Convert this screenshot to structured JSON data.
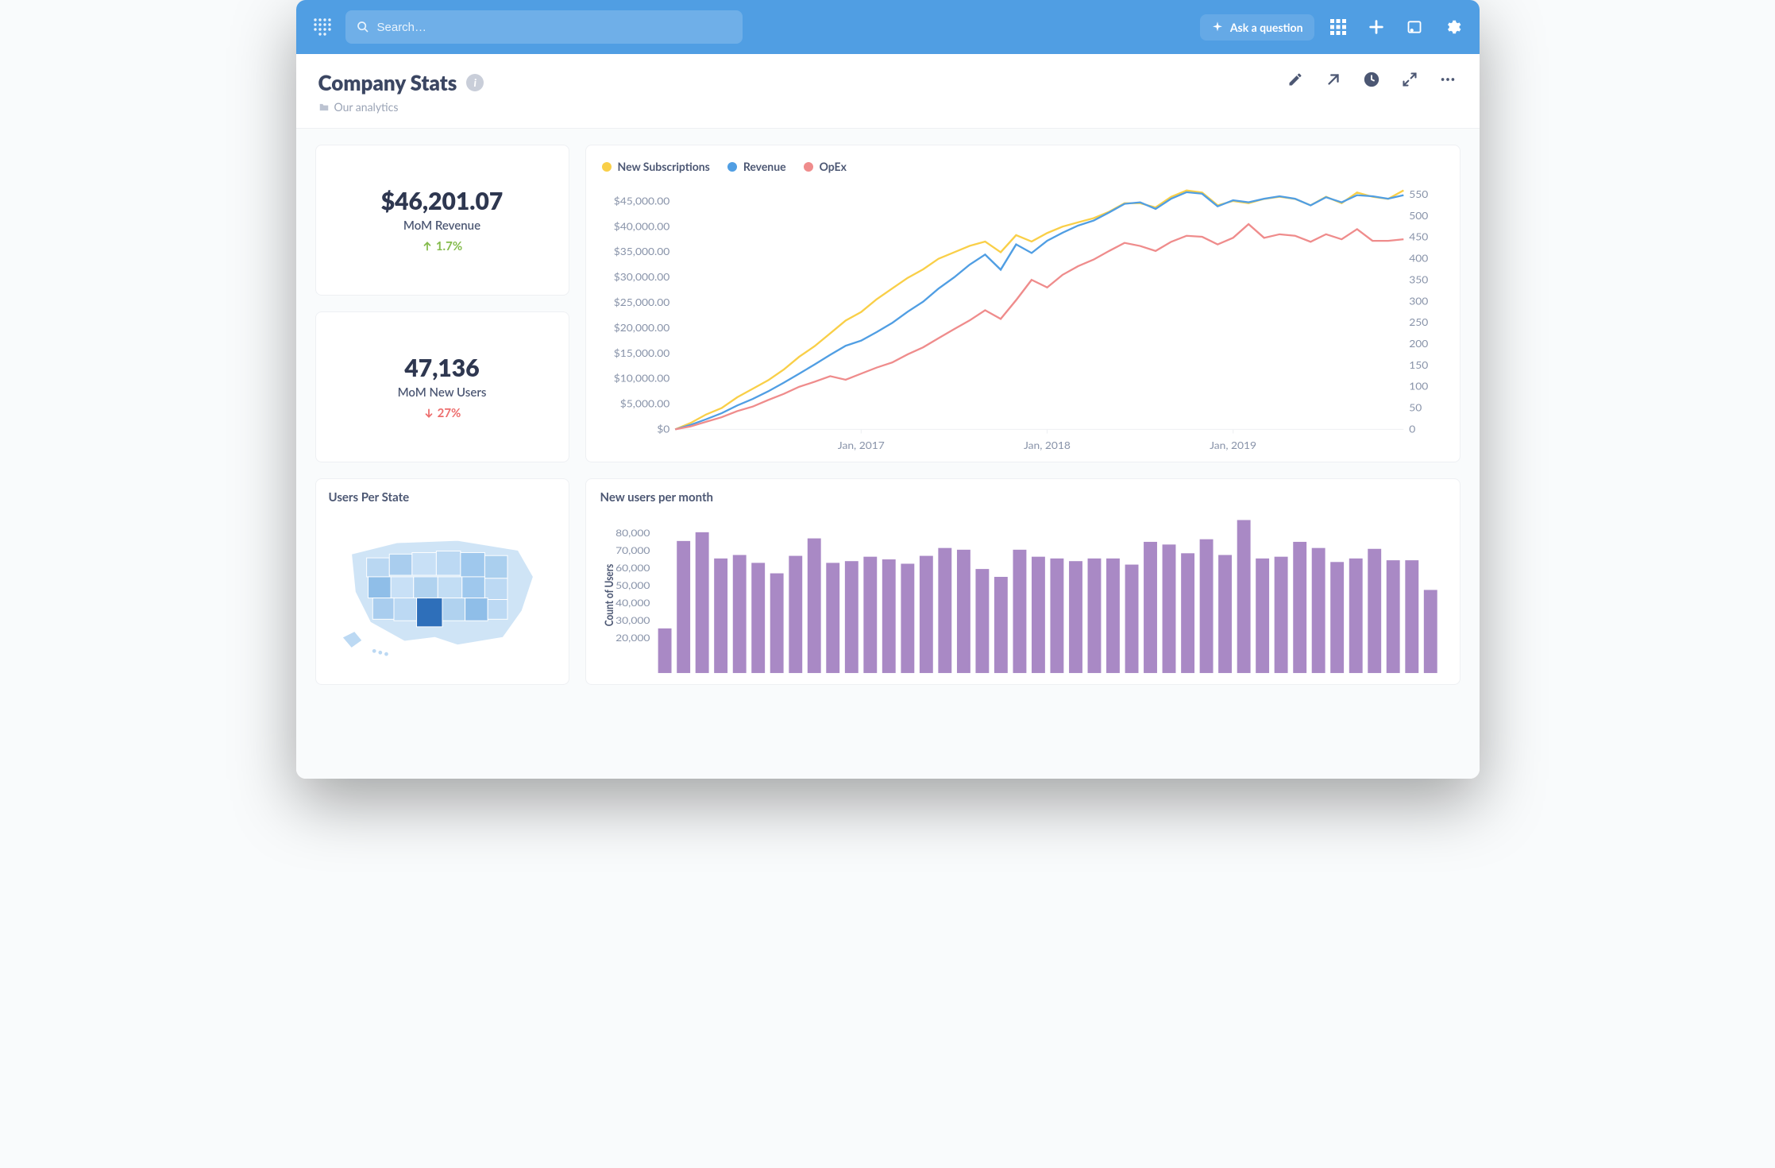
{
  "topbar": {
    "search_placeholder": "Search…",
    "ask_label": "Ask a question"
  },
  "header": {
    "title": "Company Stats",
    "breadcrumb": "Our analytics"
  },
  "kpis": [
    {
      "value": "$46,201.07",
      "label": "MoM Revenue",
      "delta": "1.7%",
      "direction": "up"
    },
    {
      "value": "47,136",
      "label": "MoM New Users",
      "delta": "27%",
      "direction": "down"
    }
  ],
  "line_chart": {
    "legend": [
      {
        "name": "New Subscriptions",
        "color": "#f9cf48"
      },
      {
        "name": "Revenue",
        "color": "#509ee3"
      },
      {
        "name": "OpEx",
        "color": "#ef8c8c"
      }
    ]
  },
  "map_card": {
    "title": "Users Per State"
  },
  "bar_card": {
    "title": "New users per month",
    "ylabel": "Count of Users"
  },
  "chart_data": [
    {
      "type": "line",
      "title": "",
      "x_ticks": [
        "Jan, 2017",
        "Jan, 2018",
        "Jan, 2019"
      ],
      "y_left_label": "",
      "y_left_ticks": [
        "$0",
        "$5,000.00",
        "$10,000.00",
        "$15,000.00",
        "$20,000.00",
        "$25,000.00",
        "$30,000.00",
        "$35,000.00",
        "$40,000.00",
        "$45,000.00"
      ],
      "y_right_ticks": [
        0,
        50,
        100,
        150,
        200,
        250,
        300,
        350,
        400,
        450,
        500,
        550
      ],
      "ylim_left": [
        0,
        48000
      ],
      "ylim_right": [
        0,
        570
      ],
      "x": [
        0,
        1,
        2,
        3,
        4,
        5,
        6,
        7,
        8,
        9,
        10,
        11,
        12,
        13,
        14,
        15,
        16,
        17,
        18,
        19,
        20,
        21,
        22,
        23,
        24,
        25,
        26,
        27,
        28,
        29,
        30,
        31,
        32,
        33,
        34,
        35,
        36,
        37,
        38,
        39,
        40,
        41,
        42,
        43,
        44,
        45,
        46,
        47
      ],
      "series": [
        {
          "name": "New Subscriptions",
          "axis": "right",
          "color": "#f9cf48",
          "values": [
            0,
            15,
            35,
            50,
            75,
            95,
            115,
            140,
            170,
            195,
            225,
            255,
            275,
            305,
            330,
            355,
            375,
            400,
            415,
            430,
            440,
            415,
            455,
            440,
            460,
            475,
            485,
            495,
            510,
            530,
            530,
            520,
            545,
            560,
            555,
            525,
            535,
            530,
            540,
            545,
            540,
            525,
            545,
            530,
            555,
            545,
            540,
            560
          ]
        },
        {
          "name": "Revenue",
          "axis": "left",
          "color": "#509ee3",
          "values": [
            0,
            900,
            2000,
            3200,
            4700,
            6000,
            7500,
            9200,
            11000,
            12800,
            14700,
            16500,
            17500,
            19200,
            21000,
            23200,
            25200,
            27800,
            30000,
            32500,
            34500,
            31500,
            36500,
            34800,
            37200,
            38800,
            40200,
            41200,
            42800,
            44500,
            44800,
            43500,
            45500,
            46800,
            46500,
            44000,
            45200,
            44800,
            45500,
            46000,
            45500,
            44200,
            45800,
            44800,
            46200,
            46000,
            45500,
            46200
          ]
        },
        {
          "name": "OpEx",
          "axis": "left",
          "color": "#ef8c8c",
          "values": [
            0,
            600,
            1500,
            2400,
            3600,
            4500,
            5800,
            7000,
            8400,
            9400,
            10500,
            9800,
            11000,
            12200,
            13200,
            14800,
            16200,
            18000,
            19800,
            21500,
            23500,
            21800,
            25500,
            29500,
            28000,
            30500,
            32200,
            33500,
            35200,
            36800,
            36200,
            35200,
            37000,
            38200,
            38000,
            36500,
            37800,
            40500,
            37800,
            38500,
            38200,
            37000,
            38500,
            37500,
            39500,
            37200,
            37200,
            37500
          ]
        }
      ]
    },
    {
      "type": "bar",
      "title": "New users per month",
      "ylabel": "Count of Users",
      "y_ticks": [
        20000,
        30000,
        40000,
        50000,
        60000,
        70000,
        80000
      ],
      "ylim": [
        0,
        90000
      ],
      "values": [
        25500,
        75500,
        80500,
        65500,
        67500,
        63000,
        57000,
        67000,
        77000,
        63000,
        64000,
        66500,
        65000,
        62500,
        67000,
        71500,
        70500,
        59500,
        55000,
        70500,
        66500,
        65500,
        64000,
        65500,
        65500,
        62000,
        75000,
        73500,
        68500,
        76500,
        67500,
        87500,
        65500,
        66500,
        75000,
        71500,
        63500,
        65500,
        71000,
        64500,
        64500,
        47500
      ]
    },
    {
      "type": "map",
      "title": "Users Per State",
      "note": "US choropleth; darker blue = higher user count; TX highlighted darkest"
    }
  ]
}
